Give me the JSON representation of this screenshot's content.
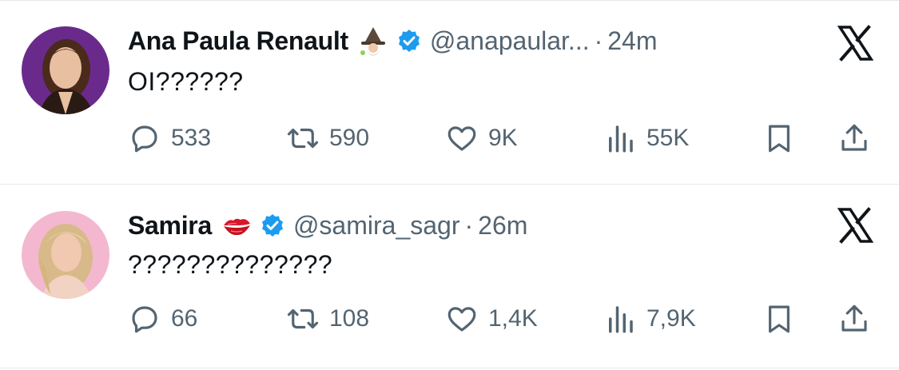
{
  "tweets": [
    {
      "name": "Ana Paula Renault",
      "name_emoji": "mage-emoji",
      "verified": true,
      "handle": "@anapaular...",
      "separator": "·",
      "time": "24m",
      "text": "OI??????",
      "avatar_bg": "#6a2a8c",
      "counts": {
        "replies": "533",
        "retweets": "590",
        "likes": "9K",
        "views": "55K"
      }
    },
    {
      "name": "Samira",
      "name_emoji": "kiss-mark-emoji",
      "verified": true,
      "handle": "@samira_sagr",
      "separator": "·",
      "time": "26m",
      "text": "??????????????",
      "avatar_bg": "#f3b8cf",
      "counts": {
        "replies": "66",
        "retweets": "108",
        "likes": "1,4K",
        "views": "7,9K"
      }
    }
  ],
  "colors": {
    "verified_blue": "#1d9bf0",
    "muted": "#536471",
    "text": "#0f1419",
    "divider": "#e6e8ea"
  },
  "icons": [
    "reply-icon",
    "retweet-icon",
    "like-icon",
    "views-icon",
    "bookmark-icon",
    "share-icon",
    "x-logo-icon",
    "verified-badge-icon"
  ]
}
